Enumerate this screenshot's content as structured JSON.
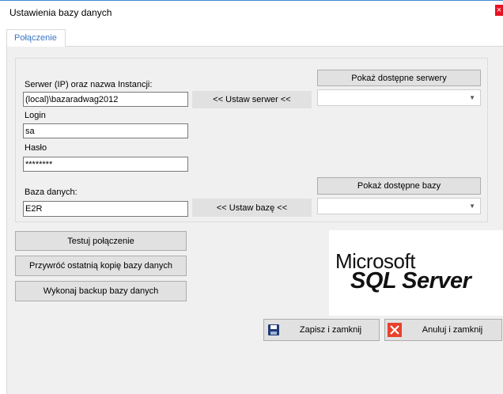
{
  "window": {
    "title": "Ustawienia bazy danych"
  },
  "tabs": [
    {
      "label": "Połączenie"
    }
  ],
  "connection": {
    "server_label": "Serwer (IP) oraz nazwa Instancji:",
    "server_value": "(local)\\bazaradwag2012",
    "set_server_button": "<< Ustaw serwer <<",
    "show_servers_button": "Pokaż dostępne serwery",
    "login_label": "Login",
    "login_value": "sa",
    "password_label": "Hasło",
    "password_value": "********",
    "database_label": "Baza danych:",
    "database_value": "E2R",
    "set_database_button": "<< Ustaw bazę <<",
    "show_databases_button": "Pokaż dostępne bazy"
  },
  "actions": {
    "test_connection": "Testuj połączenie",
    "restore_backup": "Przywróć ostatnią kopię bazy danych",
    "make_backup": "Wykonaj backup bazy danych",
    "save_close": "Zapisz i zamknij",
    "cancel_close": "Anuluj i zamknij"
  },
  "logo": {
    "line1": "Microsoft",
    "line2": "SQL Server"
  },
  "icons": {
    "save": "floppy-disk-icon",
    "cancel": "red-x-icon",
    "dropdown": "chevron-down-icon"
  },
  "colors": {
    "accent": "#3a75c4",
    "cancel_red": "#e8412c",
    "save_blue": "#1f3b73"
  }
}
